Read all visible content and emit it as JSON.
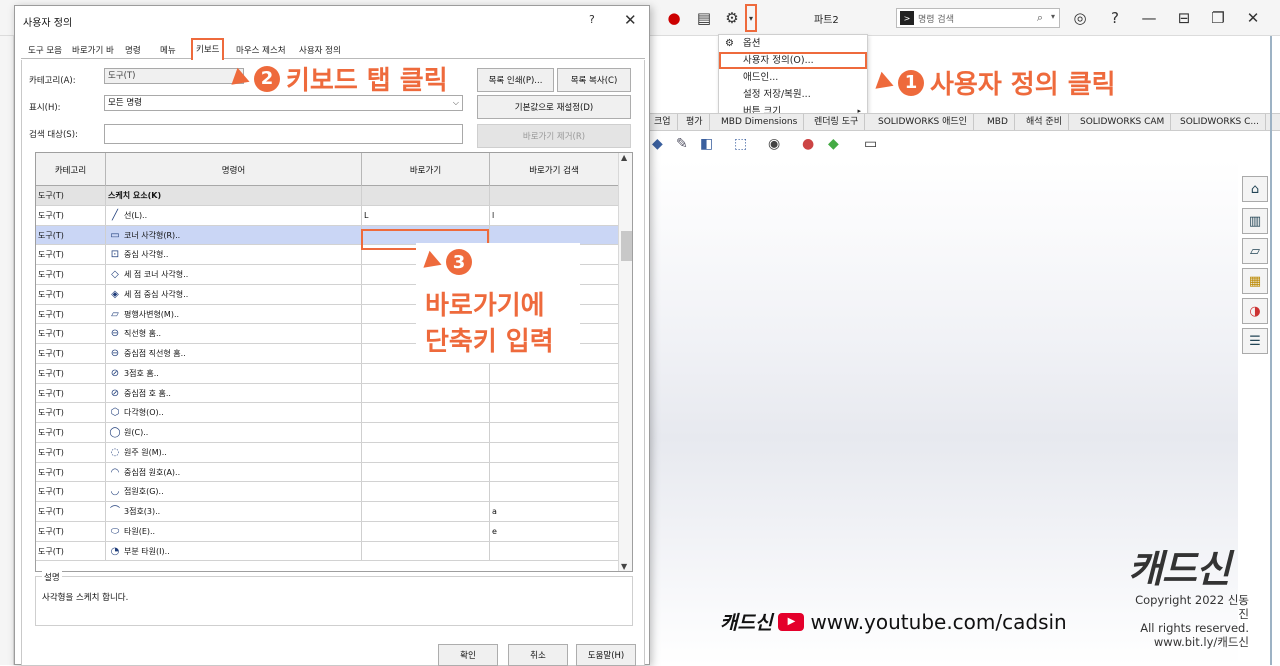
{
  "app": {
    "part_title": "파트2",
    "search_placeholder": "명령 검색"
  },
  "options_menu": {
    "items": [
      {
        "label": "옵션",
        "icon": "gear-icon"
      },
      {
        "label": "사용자 정의(O)..."
      },
      {
        "label": "애드인..."
      },
      {
        "label": "설정 저장/복원..."
      },
      {
        "label": "버튼 크기",
        "submenu": true
      }
    ]
  },
  "sw_tabs": [
    "크업",
    "평가",
    "MBD Dimensions",
    "렌더링 도구",
    "SOLIDWORKS 애드인",
    "MBD",
    "해석 준비",
    "SOLIDWORKS CAM",
    "SOLIDWORKS C..."
  ],
  "dialog": {
    "title": "사용자 정의",
    "help": "?",
    "close": "✕",
    "tabs": [
      "도구 모음",
      "바로가기 바",
      "명령",
      "메뉴",
      "키보드",
      "마우스 제스처",
      "사용자 정의"
    ],
    "category_label": "카테고리(A):",
    "category_value": "도구(T)",
    "show_label": "표시(H):",
    "show_value": "모든 명령",
    "search_label": "검색 대상(S):",
    "search_value": "",
    "btn_print": "목록 인쇄(P)...",
    "btn_copy": "목록 복사(C)",
    "btn_reset": "기본값으로 재설정(D)",
    "btn_remove": "바로가기 제거(R)",
    "columns": [
      "카테고리",
      "명령어",
      "바로가기",
      "바로가기 검색"
    ],
    "rows": [
      {
        "cat": "도구(T)",
        "cmd": "스케치 요소(K)",
        "icon": "",
        "shortcut": "",
        "search": "",
        "group": true
      },
      {
        "cat": "도구(T)",
        "cmd": "선(L)..",
        "icon": "╱",
        "shortcut": "L",
        "search": "l"
      },
      {
        "cat": "도구(T)",
        "cmd": "코너 사각형(R)..",
        "icon": "▭",
        "shortcut": "",
        "search": "",
        "selected": true
      },
      {
        "cat": "도구(T)",
        "cmd": "중심 사각형..",
        "icon": "⊡",
        "shortcut": "",
        "search": ""
      },
      {
        "cat": "도구(T)",
        "cmd": "세 점 코너 사각형..",
        "icon": "◇",
        "shortcut": "",
        "search": ""
      },
      {
        "cat": "도구(T)",
        "cmd": "세 점 중심 사각형..",
        "icon": "◈",
        "shortcut": "",
        "search": ""
      },
      {
        "cat": "도구(T)",
        "cmd": "평행사변형(M)..",
        "icon": "▱",
        "shortcut": "",
        "search": ""
      },
      {
        "cat": "도구(T)",
        "cmd": "직선형 홈..",
        "icon": "⊖",
        "shortcut": "",
        "search": ""
      },
      {
        "cat": "도구(T)",
        "cmd": "중심점 직선형 홈..",
        "icon": "⊖",
        "shortcut": "",
        "search": ""
      },
      {
        "cat": "도구(T)",
        "cmd": "3점호 홈..",
        "icon": "⊘",
        "shortcut": "",
        "search": ""
      },
      {
        "cat": "도구(T)",
        "cmd": "중심점 호 홈..",
        "icon": "⊘",
        "shortcut": "",
        "search": ""
      },
      {
        "cat": "도구(T)",
        "cmd": "다각형(O)..",
        "icon": "⬡",
        "shortcut": "",
        "search": ""
      },
      {
        "cat": "도구(T)",
        "cmd": "원(C)..",
        "icon": "◯",
        "shortcut": "",
        "search": ""
      },
      {
        "cat": "도구(T)",
        "cmd": "원주 원(M)..",
        "icon": "◌",
        "shortcut": "",
        "search": ""
      },
      {
        "cat": "도구(T)",
        "cmd": "중심점 원호(A)..",
        "icon": "◠",
        "shortcut": "",
        "search": ""
      },
      {
        "cat": "도구(T)",
        "cmd": "접원호(G)..",
        "icon": "◡",
        "shortcut": "",
        "search": ""
      },
      {
        "cat": "도구(T)",
        "cmd": "3점호(3)..",
        "icon": "⌒",
        "shortcut": "",
        "search": "a"
      },
      {
        "cat": "도구(T)",
        "cmd": "타원(E)..",
        "icon": "⬭",
        "shortcut": "",
        "search": "e"
      },
      {
        "cat": "도구(T)",
        "cmd": "부분 타원(I)..",
        "icon": "◔",
        "shortcut": "",
        "search": ""
      }
    ],
    "description_label": "설명",
    "description_text": "사각형을 스케치 합니다.",
    "btn_ok": "확인",
    "btn_cancel": "취소",
    "btn_help": "도움말(H)"
  },
  "annotations": {
    "step1_num": "1",
    "step1_text": "사용자 정의 클릭",
    "step2_num": "2",
    "step2_text": "키보드 탭 클릭",
    "step3_num": "3",
    "step3_line1": "바로가기에",
    "step3_line2": "단축키 입력"
  },
  "branding": {
    "logo": "캐드신",
    "copyright_1": "Copyright 2022 신동진",
    "copyright_2": "All rights reserved.",
    "copyright_3": "www.bit.ly/캐드신",
    "yt_brand": "캐드신",
    "yt_url": "www.youtube.com/cadsin"
  },
  "colors": {
    "accent": "#ee6a3c",
    "selected_row": "#cad6f5",
    "youtube_red": "#e4002b"
  }
}
